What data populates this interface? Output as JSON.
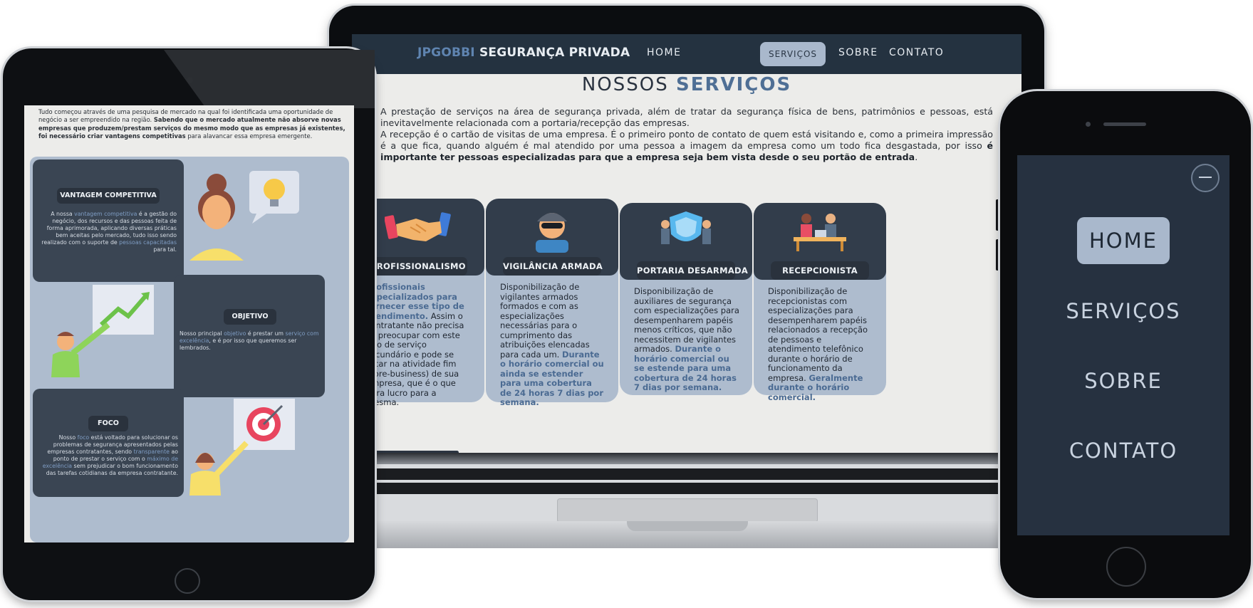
{
  "laptop": {
    "brand": {
      "part1": "JPGOBBI",
      "part2": " SEGURANÇA PRIVADA"
    },
    "nav": {
      "home": "HOME",
      "servicos": "SERVIÇOS",
      "sobre": "SOBRE",
      "contato": "CONTATO",
      "active": "SERVIÇOS"
    },
    "title": {
      "part1": "NOSSOS ",
      "part2": "SERVIÇOS"
    },
    "para1": "A prestação de serviços na área de segurança privada, além de tratar da segurança física de bens, patrimônios e pessoas, está inevitavelmente relacionada com a portaria/recepção das empresas.",
    "para2_plain": "A recepção é o cartão de visitas de uma empresa. É o primeiro ponto de contato de quem está visitando e, como a primeira impressão é a que fica, quando alguém é mal atendido por uma pessoa a imagem da empresa como um todo fica desgastada, por isso ",
    "para2_bold": "é importante ter pessoas especializadas para que a empresa seja bem vista desde o seu portão de entrada",
    "para2_end": ".",
    "cards": [
      {
        "label": "PROFISSIONALISMO",
        "icon": "handshake-icon",
        "hl": "Profissionais especializados para fornecer esse tipo de atendimento.",
        "text": " Assim o contratante não precisa se preocupar com este tipo de serviço secundário e pode se focar na atividade fim (core-business) de sua empresa, que é o que gera lucro para a mesma."
      },
      {
        "label": "VIGILÂNCIA ARMADA",
        "icon": "guard-icon",
        "text": "Disponibilização de vigilantes armados formados e com as especializações necessárias para o cumprimento das atribuições elencadas para cada um. ",
        "hl": "Durante o horário comercial ou ainda se estender para uma cobertura de 24 horas 7 dias por semana."
      },
      {
        "label": "PORTARIA DESARMADA",
        "icon": "shield-people-icon",
        "text": "Disponibilização de auxiliares de segurança com especializações para desempenharem papéis menos críticos, que não necessitem de vigilantes armados. ",
        "hl": "Durante o horário comercial ou se estende para uma cobertura de 24 horas 7 dias por semana."
      },
      {
        "label": "RECEPCIONISTA",
        "icon": "reception-desk-icon",
        "text": "Disponibilização de recepcionistas com especializações para desempenharem papéis relacionados a recepção de pessoas e atendimento telefônico durante o horário de funcionamento da empresa. ",
        "hl": "Geralmente durante o horário comercial."
      }
    ]
  },
  "tablet": {
    "intro_plain": "Tudo começou através de uma pesquisa de mercado na qual foi identificada uma oportunidade de negócio a ser empreendido na região. ",
    "intro_bold": "Sabendo que o mercado atualmente não absorve novas empresas que produzem/prestam serviços do mesmo modo que as empresas já existentes, foi necessário criar vantagens competitivas",
    "intro_end": " para alavancar essa empresa emergente.",
    "cards": [
      {
        "label": "VANTAGEM COMPETITIVA",
        "t1": "A nossa ",
        "h1": "vantagem competitiva",
        "t2": " é a gestão do negócio, dos recursos e das pessoas feita de forma aprimorada, aplicando diversas práticas bem aceitas pelo mercado, tudo isso sendo realizado com o suporte de ",
        "h2": "pessoas capacitadas",
        "t3": " para tal."
      },
      {
        "label": "OBJETIVO",
        "t1": "Nosso principal ",
        "h1": "objetivo",
        "t2": " é prestar um ",
        "h2": "serviço com excelência",
        "t3": ", e é por isso que queremos ser lembrados."
      },
      {
        "label": "FOCO",
        "t1": "Nosso ",
        "h1": "foco",
        "t2": " está voltado para solucionar os problemas de segurança apresentados pelas empresas contratantes, sendo ",
        "h2": "transparente",
        "t3": " ao ponto de prestar o serviço com o ",
        "h3": "máximo de excelência",
        "t4": " sem prejudicar o bom funcionamento das tarefas cotidianas da empresa contratante."
      }
    ]
  },
  "phone": {
    "nav": [
      "HOME",
      "SERVIÇOS",
      "SOBRE",
      "CONTATO"
    ],
    "active": "HOME",
    "close_icon": "minus-circle-icon"
  },
  "colors": {
    "nav_bg": "#243240",
    "accent": "#4f6f95",
    "card_bg": "#aebcce",
    "card_top": "#323d4b"
  }
}
